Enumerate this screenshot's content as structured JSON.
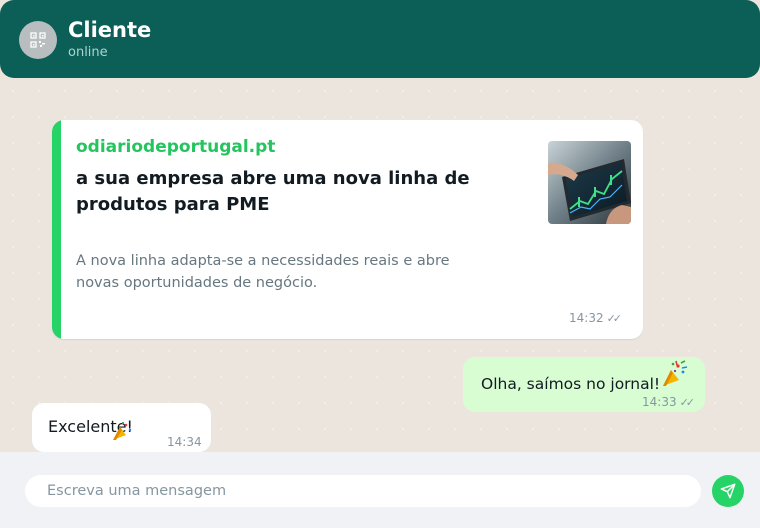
{
  "header": {
    "avatar_icon": "qr-code-icon",
    "name": "Cliente",
    "status": "online"
  },
  "messages": {
    "link_card": {
      "site": "odiariodeportugal.pt",
      "headline": "a sua empresa abre uma nova linha de produtos para PME",
      "summary": "A nova linha adapta-se a necessidades reais e abre novas oportunidades de negócio.",
      "thumbnail_icon": "tablet-stock-chart-image",
      "time": "14:32",
      "read_ticks": "✓✓"
    },
    "outgoing": {
      "text": "Olha, saímos no jornal!",
      "emoji_icon": "party-popper-icon",
      "time": "14:33",
      "read_ticks": "✓✓"
    },
    "incoming": {
      "text": "Excelente!",
      "emoji_icon": "party-popper-icon",
      "time": "14:34"
    }
  },
  "composer": {
    "placeholder": "Escreva uma mensagem",
    "send_icon": "send-icon"
  },
  "colors": {
    "header": "#0b5f57",
    "accent": "#25d366",
    "chat_bg": "#ece5de",
    "outgoing_bubble": "#d9fdd3",
    "incoming_bubble": "#ffffff"
  }
}
